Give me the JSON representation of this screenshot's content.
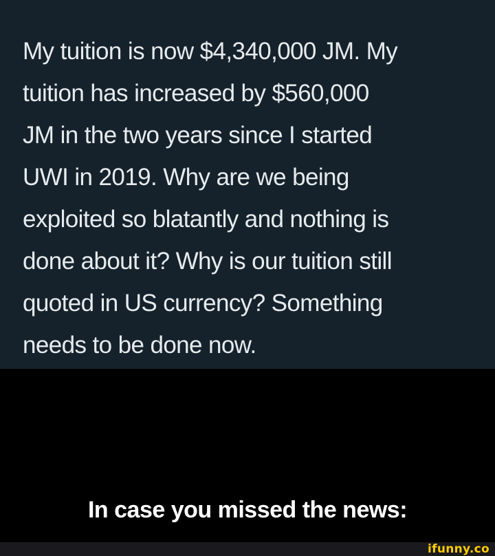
{
  "post": {
    "lines": [
      "My tuition is now $4,340,000 JM. My",
      "tuition has increased by $560,000",
      "JM in the two years since I started",
      "UWI in 2019. Why are we being",
      "exploited so blatantly and nothing is",
      "done about it? Why is our tuition still",
      "quoted in US currency? Something",
      "needs to be done now."
    ]
  },
  "caption": "In case you missed the news:",
  "watermark": "ifunny.co",
  "colors": {
    "post_background": "#16222b",
    "post_text": "#e6ebee",
    "page_background": "#000000",
    "caption_text": "#ffffff",
    "footer_background": "#1a1a1e",
    "watermark": "#ffcc00"
  }
}
